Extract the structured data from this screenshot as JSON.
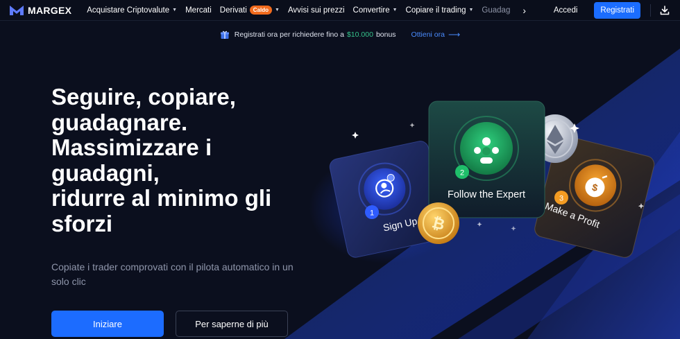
{
  "brand": {
    "name": "MARGEX"
  },
  "nav": {
    "items": [
      {
        "label": "Acquistare Criptovalute",
        "caret": true
      },
      {
        "label": "Mercati",
        "caret": false
      },
      {
        "label": "Derivati",
        "caret": true,
        "badge": "Caldo"
      },
      {
        "label": "Avvisi sui prezzi",
        "caret": false
      },
      {
        "label": "Convertire",
        "caret": true
      },
      {
        "label": "Copiare il trading",
        "caret": true
      },
      {
        "label": "Guadag",
        "caret": false,
        "faded": true
      }
    ],
    "more_arrow": "›",
    "login": "Accedi",
    "register": "Registrati",
    "download_icon": "download-icon"
  },
  "promo": {
    "text": "Registrati ora per richiedere fino a",
    "amount": "$10.000",
    "bonus_word": "bonus",
    "link": "Ottieni ora",
    "arrow": "⟶"
  },
  "hero": {
    "title_lines": [
      "Seguire, copiare,",
      "guadagnare.",
      "Massimizzare i",
      "guadagni,",
      "ridurre al minimo gli",
      "sforzi"
    ],
    "subtitle": "Copiate i trader comprovati con il pilota automatico in un solo clic",
    "primary_button": "Iniziare",
    "secondary_button": "Per saperne di più"
  },
  "illustration": {
    "steps": [
      {
        "number": "1",
        "label": "Sign Up",
        "color": "#2f5cff"
      },
      {
        "number": "2",
        "label": "Follow the Expert",
        "color": "#1fbf6a"
      },
      {
        "number": "3",
        "label": "Make a Profit",
        "color": "#f39b22"
      }
    ]
  },
  "colors": {
    "background": "#0b0f1e",
    "accent": "#1c6cff",
    "badge": "#f26b1d",
    "promo_amount": "#35c38b"
  }
}
